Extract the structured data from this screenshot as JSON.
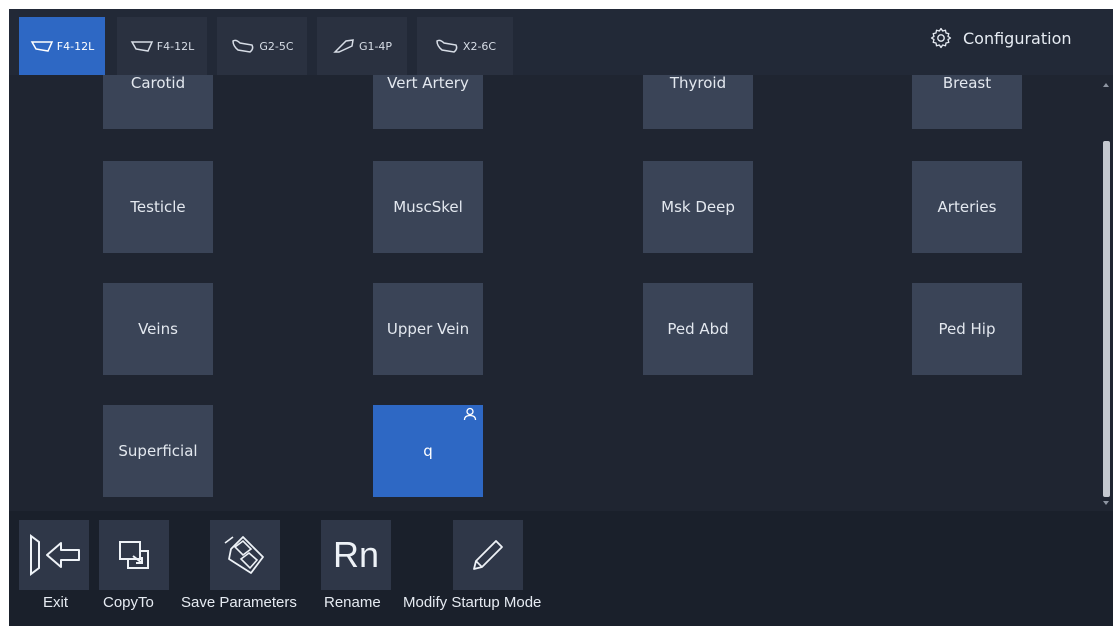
{
  "tabs": [
    {
      "label": "F4-12L",
      "icon": "linear-probe-icon",
      "active": true
    },
    {
      "label": "F4-12L",
      "icon": "linear-probe-icon",
      "active": false
    },
    {
      "label": "G2-5C",
      "icon": "convex-probe-icon",
      "active": false
    },
    {
      "label": "G1-4P",
      "icon": "phased-probe-icon",
      "active": false
    },
    {
      "label": "X2-6C",
      "icon": "convex-probe-icon",
      "active": false
    }
  ],
  "configuration": {
    "label": "Configuration",
    "icon": "gear-icon"
  },
  "exams": [
    {
      "label": "Carotid"
    },
    {
      "label": "Vert Artery"
    },
    {
      "label": "Thyroid"
    },
    {
      "label": "Breast"
    },
    {
      "label": "Testicle"
    },
    {
      "label": "MuscSkel"
    },
    {
      "label": "Msk Deep"
    },
    {
      "label": "Arteries"
    },
    {
      "label": "Veins"
    },
    {
      "label": "Upper Vein"
    },
    {
      "label": "Ped Abd"
    },
    {
      "label": "Ped Hip"
    },
    {
      "label": "Superficial"
    },
    {
      "label": "q",
      "user_defined": true,
      "selected": true,
      "icon": "user-icon"
    }
  ],
  "toolbar": {
    "exit": {
      "label": "Exit",
      "icon": "exit-icon"
    },
    "copyto": {
      "label": "CopyTo",
      "icon": "copy-icon"
    },
    "save": {
      "label": "Save Parameters",
      "icon": "save-icon"
    },
    "rename": {
      "label": "Rename",
      "icon_text": "Rn"
    },
    "modify": {
      "label": "Modify Startup Mode",
      "icon": "pencil-icon"
    }
  },
  "colors": {
    "accent": "#2e68c4",
    "tile": "#3a4457",
    "background": "#1f2531"
  }
}
